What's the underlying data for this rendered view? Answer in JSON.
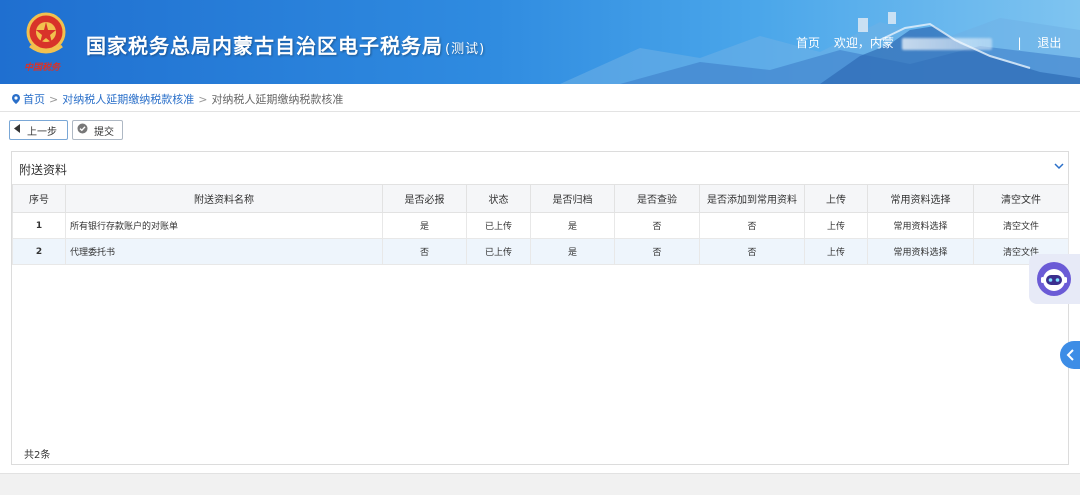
{
  "header": {
    "title": "国家税务总局内蒙古自治区电子税务局",
    "title_suffix": "(测试)",
    "home_link": "首页",
    "welcome": "欢迎，内蒙",
    "separator": "|",
    "logout": "退出",
    "emblem_text": "中国税务"
  },
  "breadcrumb": {
    "home": "首页",
    "sep1": ">",
    "level1": "对纳税人延期缴纳税款核准",
    "sep2": ">",
    "current": "对纳税人延期缴纳税款核准"
  },
  "toolbar": {
    "prev_label": "上一步",
    "submit_label": "提交"
  },
  "panel": {
    "title": "附送资料",
    "columns": [
      "序号",
      "附送资料名称",
      "是否必报",
      "状态",
      "是否归档",
      "是否查验",
      "是否添加到常用资料",
      "上传",
      "常用资料选择",
      "清空文件"
    ],
    "rows": [
      [
        "1",
        "所有银行存款账户的对账单",
        "是",
        "已上传",
        "是",
        "否",
        "否",
        "上传",
        "常用资料选择",
        "清空文件"
      ],
      [
        "2",
        "代理委托书",
        "否",
        "已上传",
        "是",
        "否",
        "否",
        "上传",
        "常用资料选择",
        "清空文件"
      ]
    ],
    "total": "共2条"
  },
  "colors": {
    "header_blue": "#1f6fd0",
    "link_blue": "#2a6fc9",
    "row_highlight": "#eef5fc",
    "robot_purple": "#6b5bd6"
  },
  "icons": [
    "emblem-icon",
    "location-pin-icon",
    "triangle-left-icon",
    "check-circle-icon",
    "chevron-down-icon",
    "robot-assistant-icon",
    "chevron-left-icon"
  ]
}
